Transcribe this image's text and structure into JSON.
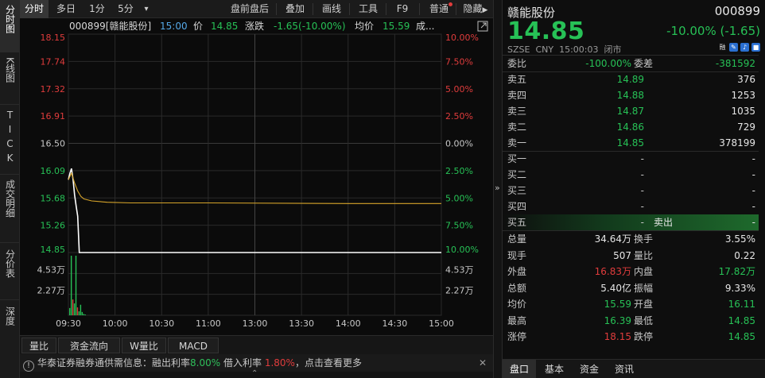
{
  "vtabs": {
    "intraday": "分时图",
    "kline": "K线图",
    "tick": "TICK",
    "trades": "成交明细",
    "price_table": "分价表",
    "depth": "深度"
  },
  "toolbar": {
    "intraday": "分时",
    "multiday": "多日",
    "min1": "1分",
    "min5": "5分",
    "more": "▾",
    "prepost": "盘前盘后",
    "overlay": "叠加",
    "draw": "画线",
    "tools": "工具",
    "f9": "F9",
    "normal": "普通",
    "hide": "隐藏"
  },
  "chart_header": {
    "code_name": "000899[赣能股份]",
    "time": "15:00",
    "price_label": "价",
    "price": "14.85",
    "change_label": "涨跌",
    "change": "-1.65(-10.00%)",
    "avg_label": "均价",
    "avg": "15.59",
    "more": "成..."
  },
  "colors": {
    "up": "#e03c3c",
    "down": "#27c156",
    "flat": "#c8c8c8",
    "price_line": "#ffffff",
    "avg_line": "#d6a42a",
    "grid": "#2a2a2a"
  },
  "chart_data": {
    "type": "line",
    "x_ticks": [
      "09:30",
      "10:00",
      "10:30",
      "11:00",
      "13:00",
      "13:30",
      "14:00",
      "14:30",
      "15:00"
    ],
    "price_ticks": [
      "18.15",
      "17.74",
      "17.32",
      "16.91",
      "16.50",
      "16.09",
      "15.68",
      "15.26",
      "14.85"
    ],
    "pct_ticks": [
      "10.00%",
      "7.50%",
      "5.00%",
      "2.50%",
      "0.00%",
      "2.50%",
      "5.00%",
      "7.50%",
      "10.00%"
    ],
    "volume_ticks": [
      "4.53万",
      "2.27万"
    ],
    "ylim": [
      14.85,
      18.15
    ],
    "prev_close": 16.5,
    "series": [
      {
        "name": "价",
        "points": [
          [
            0,
            15.95
          ],
          [
            1,
            16.05
          ],
          [
            2,
            16.12
          ],
          [
            3,
            15.95
          ],
          [
            4,
            15.72
          ],
          [
            5,
            15.55
          ],
          [
            6,
            15.4
          ],
          [
            7,
            14.85
          ],
          [
            8,
            14.85
          ],
          [
            10,
            14.85
          ],
          [
            20,
            14.85
          ],
          [
            60,
            14.85
          ],
          [
            120,
            14.85
          ],
          [
            180,
            14.85
          ],
          [
            240,
            14.85
          ]
        ]
      },
      {
        "name": "均价",
        "points": [
          [
            0,
            15.95
          ],
          [
            2,
            16.05
          ],
          [
            4,
            15.9
          ],
          [
            6,
            15.78
          ],
          [
            8,
            15.7
          ],
          [
            10,
            15.66
          ],
          [
            15,
            15.63
          ],
          [
            25,
            15.61
          ],
          [
            40,
            15.6
          ],
          [
            90,
            15.6
          ],
          [
            180,
            15.59
          ],
          [
            240,
            15.59
          ]
        ]
      }
    ],
    "volume": [
      {
        "x": 0,
        "v": 0.55,
        "up": false
      },
      {
        "x": 1,
        "v": 4.53,
        "up": false
      },
      {
        "x": 2,
        "v": 1.2,
        "up": true
      },
      {
        "x": 3,
        "v": 0.9,
        "up": false
      },
      {
        "x": 4,
        "v": 4.53,
        "up": false
      },
      {
        "x": 5,
        "v": 0.6,
        "up": true
      },
      {
        "x": 6,
        "v": 0.3,
        "up": false
      },
      {
        "x": 7,
        "v": 0.8,
        "up": false
      },
      {
        "x": 8,
        "v": 0.25,
        "up": false
      },
      {
        "x": 9,
        "v": 0.1,
        "up": false
      },
      {
        "x": 10,
        "v": 0.05,
        "up": false
      }
    ],
    "volume_max": 4.53
  },
  "bottom_tabs": {
    "volume": "量比",
    "flow": "资金流向",
    "w": "W量比",
    "macd": "MACD"
  },
  "notice": {
    "icon": "!",
    "prefix": "华泰证券融券通供需信息：融出利率",
    "lend_rate": "8.00%",
    "mid": "借入利率",
    "borrow_rate": "1.80%",
    "suffix": "，点击查看更多",
    "expand": "⌃"
  },
  "quote": {
    "name": "赣能股份",
    "code": "000899",
    "price": "14.85",
    "change": "-10.00% (-1.65)",
    "exchange": "SZSE",
    "currency": "CNY",
    "time": "15:00:03",
    "status": "闭市",
    "icons": [
      "融",
      "pencil-icon",
      "bell-icon",
      "lock-icon"
    ],
    "ratio_label": "委比",
    "ratio": "-100.00%",
    "diff_label": "委差",
    "diff": "-381592"
  },
  "asks": [
    {
      "label": "卖五",
      "price": "14.89",
      "vol": "376"
    },
    {
      "label": "卖四",
      "price": "14.88",
      "vol": "1253"
    },
    {
      "label": "卖三",
      "price": "14.87",
      "vol": "1035"
    },
    {
      "label": "卖二",
      "price": "14.86",
      "vol": "729"
    },
    {
      "label": "卖一",
      "price": "14.85",
      "vol": "378199"
    }
  ],
  "bids": [
    {
      "label": "买一",
      "price": "-",
      "vol": "-"
    },
    {
      "label": "买二",
      "price": "-",
      "vol": "-"
    },
    {
      "label": "买三",
      "price": "-",
      "vol": "-"
    },
    {
      "label": "买四",
      "price": "-",
      "vol": "-"
    },
    {
      "label": "买五",
      "price": "-",
      "extra": "卖出",
      "vol": "-"
    }
  ],
  "stats": [
    {
      "l1": "总量",
      "v1": "34.64万",
      "c1": "white",
      "l2": "换手",
      "v2": "3.55%",
      "c2": "white"
    },
    {
      "l1": "现手",
      "v1": "507",
      "c1": "white",
      "l2": "量比",
      "v2": "0.22",
      "c2": "white"
    },
    {
      "l1": "外盘",
      "v1": "16.83万",
      "c1": "red",
      "l2": "内盘",
      "v2": "17.82万",
      "c2": "green"
    },
    {
      "l1": "总额",
      "v1": "5.40亿",
      "c1": "white",
      "l2": "振幅",
      "v2": "9.33%",
      "c2": "white"
    },
    {
      "l1": "均价",
      "v1": "15.59",
      "c1": "green",
      "l2": "开盘",
      "v2": "16.11",
      "c2": "green"
    },
    {
      "l1": "最高",
      "v1": "16.39",
      "c1": "green",
      "l2": "最低",
      "v2": "14.85",
      "c2": "green"
    },
    {
      "l1": "涨停",
      "v1": "18.15",
      "c1": "red",
      "l2": "跌停",
      "v2": "14.85",
      "c2": "green"
    }
  ],
  "rp_tabs": {
    "quote": "盘口",
    "basic": "基本",
    "capital": "资金",
    "news": "资讯"
  }
}
